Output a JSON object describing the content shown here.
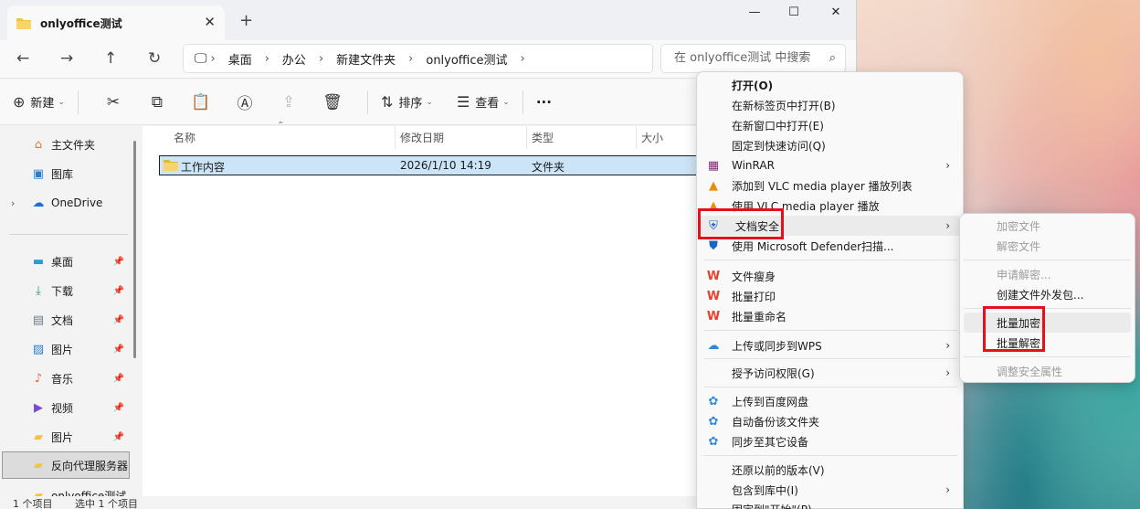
{
  "colors": {
    "highlight_box": "#e4101a",
    "selection": "#cce4f7",
    "folder": "#f5c244",
    "accent": "#0067c0"
  },
  "window": {
    "tab_title": "onlyoffice测试",
    "tab_icon": "folder-icon",
    "controls": [
      "minimize-icon",
      "maximize-icon",
      "close-icon"
    ]
  },
  "address": {
    "crumbs": [
      "桌面",
      "办公",
      "新建文件夹",
      "onlyoffice测试"
    ],
    "search_placeholder": "在 onlyoffice测试 中搜索"
  },
  "toolbar": {
    "new_label": "新建",
    "sort_label": "排序",
    "view_label": "查看",
    "more_label": "···",
    "icons": [
      "cut-icon",
      "copy-icon",
      "paste-icon",
      "rename-icon",
      "share-icon",
      "delete-icon"
    ]
  },
  "nav": {
    "items": [
      {
        "label": "主文件夹",
        "icon": "home-icon"
      },
      {
        "label": "图库",
        "icon": "gallery-icon"
      },
      {
        "label": "OneDrive",
        "icon": "cloud-icon"
      },
      {
        "label": "桌面",
        "icon": "desktop-icon"
      },
      {
        "label": "下载",
        "icon": "download-icon"
      },
      {
        "label": "文档",
        "icon": "document-icon"
      },
      {
        "label": "图片",
        "icon": "pictures-icon"
      },
      {
        "label": "音乐",
        "icon": "music-icon"
      },
      {
        "label": "视频",
        "icon": "video-icon"
      },
      {
        "label": "图片",
        "icon": "folder-icon"
      },
      {
        "label": "反向代理服务器",
        "icon": "folder-icon"
      },
      {
        "label": "onlyoffice测试",
        "icon": "folder-icon"
      }
    ]
  },
  "columns": {
    "name": "名称",
    "modified": "修改日期",
    "type": "类型",
    "size": "大小"
  },
  "files": [
    {
      "name": "工作内容",
      "modified": "2026/1/10 14:19",
      "type": "文件夹",
      "icon": "folder-icon"
    }
  ],
  "status": {
    "count": "1 个项目",
    "selected": "选中 1 个项目"
  },
  "context_menu": {
    "items": [
      {
        "label": "打开(O)",
        "bold": true
      },
      {
        "label": "在新标签页中打开(B)"
      },
      {
        "label": "在新窗口中打开(E)"
      },
      {
        "label": "固定到快速访问(Q)"
      },
      {
        "label": "WinRAR",
        "icon": "winrar-icon",
        "submenu": true
      },
      {
        "label": "添加到 VLC media player 播放列表",
        "icon": "vlc-icon"
      },
      {
        "label": "使用 VLC media player 播放",
        "icon": "vlc-icon"
      },
      {
        "label": "文档安全",
        "icon": "shield-icon",
        "submenu": true
      },
      {
        "label": "使用 Microsoft Defender扫描...",
        "icon": "defender-icon"
      },
      {
        "label": "文件瘦身",
        "icon": "wps-icon"
      },
      {
        "label": "批量打印",
        "icon": "wps-icon"
      },
      {
        "label": "批量重命名",
        "icon": "wps-icon"
      },
      {
        "label": "上传或同步到WPS",
        "icon": "wps-cloud-icon",
        "submenu": true
      },
      {
        "label": "授予访问权限(G)",
        "submenu": true
      },
      {
        "label": "上传到百度网盘",
        "icon": "baidu-icon"
      },
      {
        "label": "自动备份该文件夹",
        "icon": "baidu-icon"
      },
      {
        "label": "同步至其它设备",
        "icon": "baidu-icon"
      },
      {
        "label": "还原以前的版本(V)"
      },
      {
        "label": "包含到库中(I)",
        "submenu": true
      },
      {
        "label": "固定到\"开始\"(P)"
      }
    ]
  },
  "submenu": {
    "items": [
      {
        "label": "加密文件",
        "disabled": true
      },
      {
        "label": "解密文件",
        "disabled": true
      },
      {
        "label": "申请解密...",
        "disabled": true
      },
      {
        "label": "创建文件外发包..."
      },
      {
        "label": "批量加密"
      },
      {
        "label": "批量解密"
      },
      {
        "label": "调整安全属性",
        "disabled": true
      }
    ]
  }
}
